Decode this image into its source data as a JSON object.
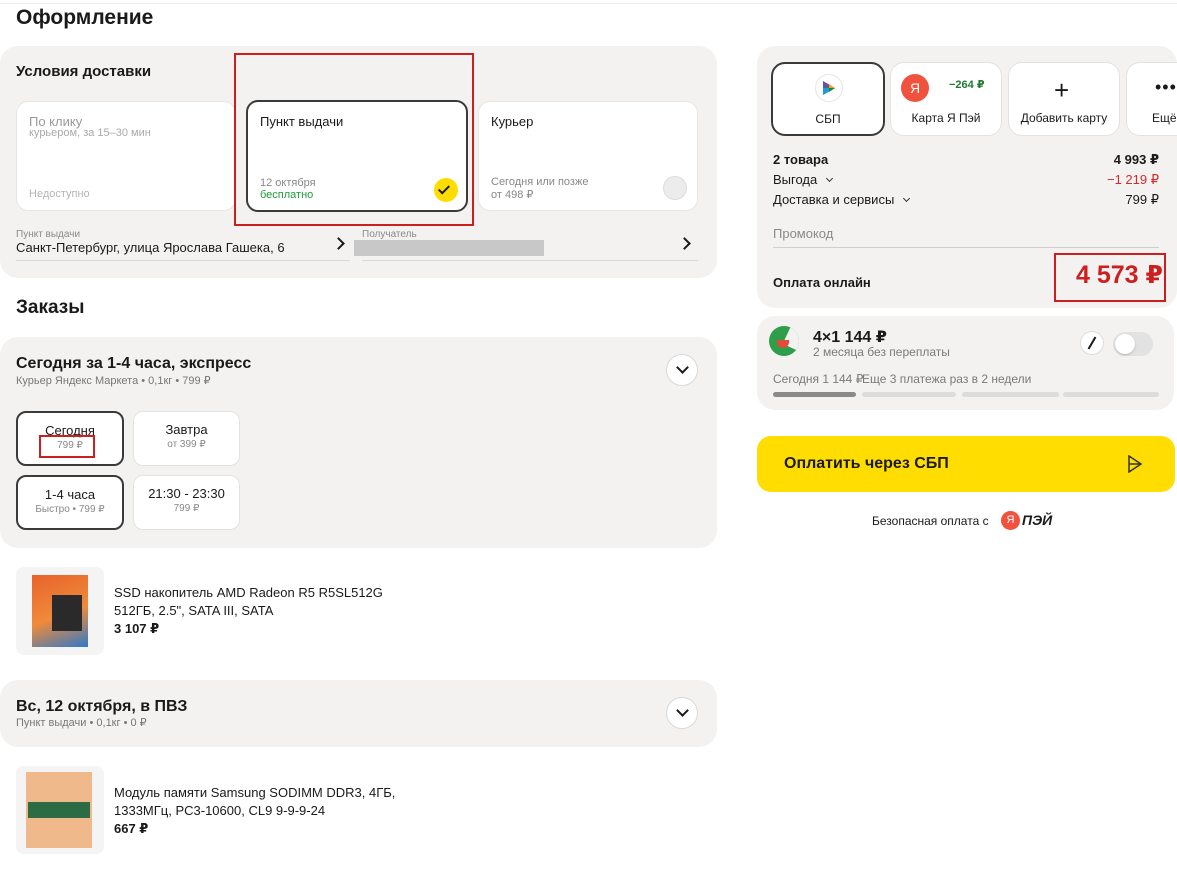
{
  "page": {
    "title": "Оформление"
  },
  "delivery": {
    "heading": "Условия доставки",
    "options": [
      {
        "title": "По клику",
        "subtitle": "курьером, за 15–30 мин",
        "note": "Недоступно"
      },
      {
        "title": "Пункт выдачи",
        "date": "12 октября",
        "price": "бесплатно"
      },
      {
        "title": "Курьер",
        "note": "Сегодня или позже",
        "price": "от 498 ₽"
      }
    ],
    "pickup_label": "Пункт выдачи",
    "pickup_address": "Санкт-Петербург, улица Ярослава Гашека, 6",
    "recipient_label": "Получатель"
  },
  "orders": {
    "heading": "Заказы",
    "groups": [
      {
        "title": "Сегодня за 1-4 часа, экспресс",
        "subtitle": "Курьер Яндекс Маркета • 0,1кг • 799 ₽",
        "slots": [
          {
            "title": "Сегодня",
            "sub": "799 ₽"
          },
          {
            "title": "Завтра",
            "sub": "от 399 ₽"
          },
          {
            "title": "1-4 часа",
            "sub": "Быстро • 799 ₽"
          },
          {
            "title": "21:30 - 23:30",
            "sub": "799 ₽"
          }
        ],
        "item": {
          "name_line1": "SSD накопитель AMD Radeon R5 R5SL512G",
          "name_line2": "512ГБ, 2.5\", SATA III, SATA",
          "price": "3 107 ₽"
        }
      },
      {
        "title": "Вс, 12 октября, в ПВЗ",
        "subtitle": "Пункт выдачи • 0,1кг • 0 ₽",
        "item": {
          "name_line1": "Модуль памяти Samsung SODIMM DDR3, 4ГБ,",
          "name_line2": "1333МГц, PC3-10600, CL9 9-9-9-24",
          "price": "667 ₽"
        }
      }
    ]
  },
  "payment": {
    "methods": [
      {
        "label": "СБП",
        "icon": "sbp-icon"
      },
      {
        "label": "Карта Я Пэй",
        "badge": "−264 ₽",
        "icon": "yandex-icon"
      },
      {
        "label": "Добавить карту",
        "icon": "plus-icon"
      },
      {
        "label": "Ещё",
        "icon": "more-icon"
      }
    ],
    "summary": {
      "items_label": "2 товара",
      "items_value": "4 993 ₽",
      "benefit_label": "Выгода",
      "benefit_value": "−1 219 ₽",
      "delivery_label": "Доставка и сервисы",
      "delivery_value": "799 ₽",
      "promo_placeholder": "Промокод",
      "total_label": "Оплата онлайн",
      "total_value": "4 573 ₽"
    },
    "split": {
      "title": "4×1 144 ₽",
      "subtitle": "2 месяца без переплаты",
      "today": "Сегодня 1 144 ₽",
      "next": "Еще 3 платежа раз в 2 недели"
    },
    "pay_button": "Оплатить через СБП",
    "secure_text": "Безопасная оплата с",
    "brand_text": "ПЭЙ",
    "colors": {
      "accent": "#ffdd00",
      "benefit": "#d42a2a",
      "highlight": "#cc1f1f",
      "free": "#1f9d3a"
    }
  }
}
